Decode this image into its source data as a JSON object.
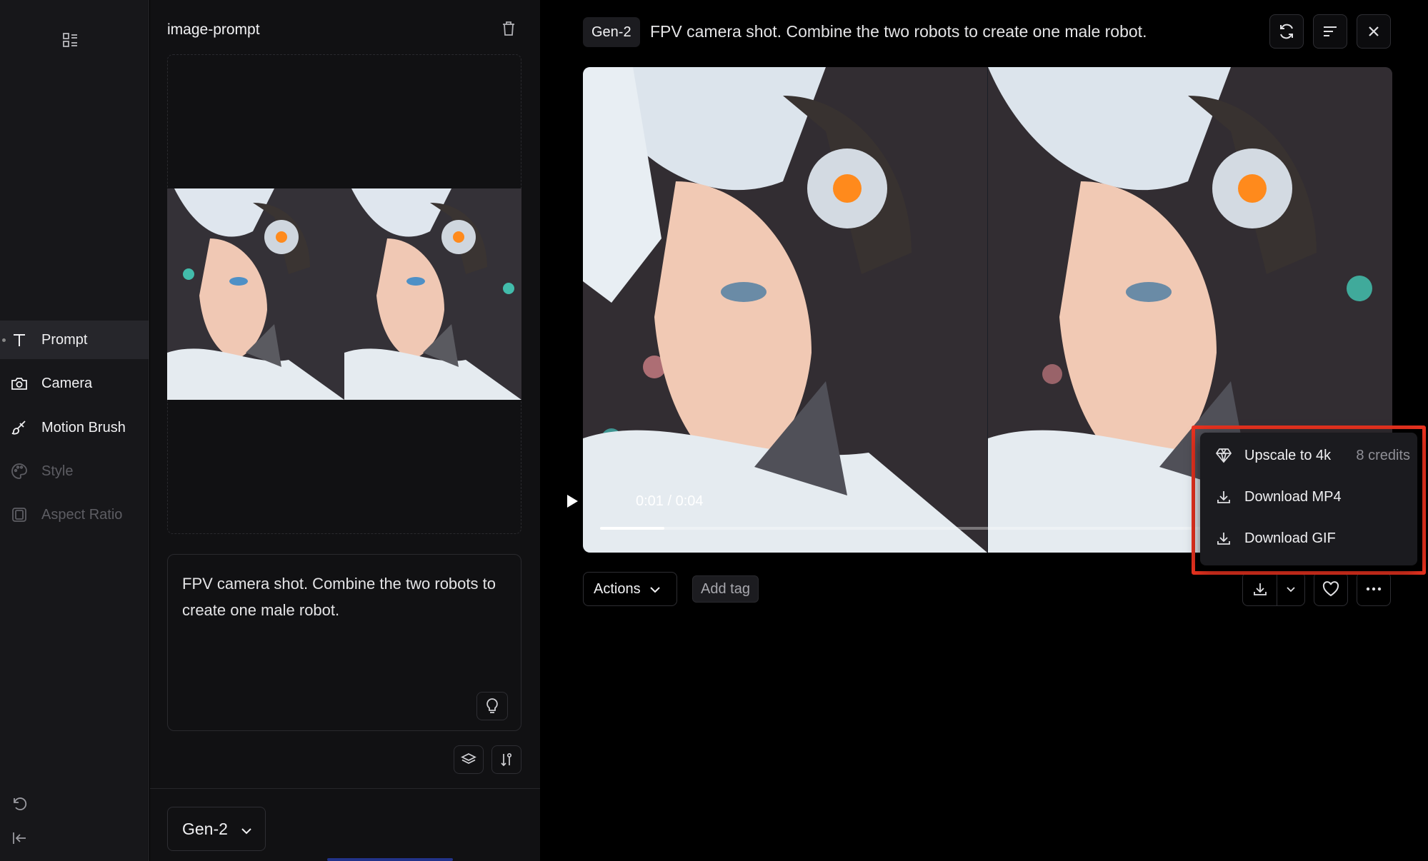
{
  "nav": {
    "items": [
      {
        "label": "Prompt",
        "icon": "text-icon",
        "state": "active"
      },
      {
        "label": "Camera",
        "icon": "camera-icon",
        "state": "normal"
      },
      {
        "label": "Motion Brush",
        "icon": "brush-icon",
        "state": "normal"
      },
      {
        "label": "Style",
        "icon": "palette-icon",
        "state": "disabled"
      },
      {
        "label": "Aspect Ratio",
        "icon": "aspect-ratio-icon",
        "state": "disabled"
      }
    ]
  },
  "panel": {
    "title": "image-prompt",
    "prompt_text": "FPV camera shot. Combine the two robots to create one male robot.",
    "model": "Gen-2"
  },
  "main": {
    "badge": "Gen-2",
    "title": "FPV camera shot. Combine the two robots to create one male robot.",
    "video": {
      "timecode": "0:01 / 0:04",
      "progress": 0.1
    },
    "actions_label": "Actions",
    "add_tag_label": "Add tag"
  },
  "menu": {
    "items": [
      {
        "label": "Upscale to 4k",
        "icon": "diamond-icon",
        "extra": "8 credits"
      },
      {
        "label": "Download MP4",
        "icon": "download-icon",
        "extra": ""
      },
      {
        "label": "Download GIF",
        "icon": "download-icon",
        "extra": ""
      }
    ]
  },
  "colors": {
    "highlight": "#e8321f",
    "panel_bg": "#111113",
    "nav_bg": "#17171a"
  }
}
